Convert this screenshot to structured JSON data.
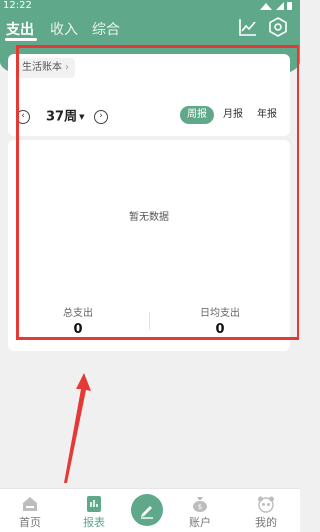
{
  "status_bar": {
    "time": "12:22"
  },
  "top_tabs": [
    {
      "label": "支出",
      "active": true
    },
    {
      "label": "收入",
      "active": false
    },
    {
      "label": "综合",
      "active": false
    }
  ],
  "header_icons": [
    "line-chart-icon",
    "settings-hexagon-icon"
  ],
  "ledger": {
    "label": "生活账本",
    "chevron": "›"
  },
  "week": {
    "prev": "‹",
    "label": "37周",
    "caret": "▼",
    "next": "›"
  },
  "period_tabs": [
    {
      "label": "周报",
      "active": true
    },
    {
      "label": "月报",
      "active": false
    },
    {
      "label": "年报",
      "active": false
    }
  ],
  "main": {
    "empty_text": "暂无数据",
    "total": {
      "label": "总支出",
      "value": "0"
    },
    "daily_avg": {
      "label": "日均支出",
      "value": "0"
    }
  },
  "bottom_nav": [
    {
      "label": "首页",
      "icon": "home-icon",
      "active": false
    },
    {
      "label": "报表",
      "icon": "report-icon",
      "active": true
    },
    {
      "label": "",
      "icon": "edit-pencil-icon",
      "active": false
    },
    {
      "label": "账户",
      "icon": "money-bag-icon",
      "active": false
    },
    {
      "label": "我的",
      "icon": "panda-profile-icon",
      "active": false
    }
  ],
  "colors": {
    "brand": "#5fa889",
    "annotation": "#e53935"
  }
}
